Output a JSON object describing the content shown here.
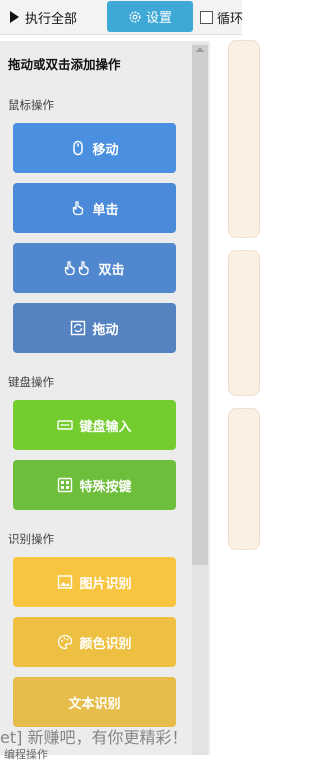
{
  "toolbar": {
    "run_all": "执行全部",
    "settings": "设置",
    "loop_label": "循环"
  },
  "panel": {
    "title": "拖动或双击添加操作",
    "sections": {
      "mouse": "鼠标操作",
      "keyboard": "键盘操作",
      "recognition": "识别操作"
    },
    "buttons": {
      "move": "移动",
      "click": "单击",
      "double_click": "双击",
      "drag": "拖动",
      "keyboard_input": "键盘输入",
      "special_key": "特殊按键",
      "image_recognition": "图片识别",
      "color_recognition": "颜色识别",
      "text_recognition": "文本识别"
    }
  },
  "watermark": "et] 新赚吧，有你更精彩！",
  "footer_partial": "编程操作",
  "colors": {
    "settings_blue": "#3ea8d6",
    "mouse_blue": "#4a8fe0",
    "keyboard_green": "#6fc33a",
    "recognition_yellow": "#f5c541"
  },
  "icons": {
    "move": "mouse-icon",
    "click": "hand-pointer-icon",
    "double_click": "double-hand-icon",
    "drag": "drag-icon",
    "keyboard_input": "keyboard-icon",
    "special_key": "special-key-icon",
    "image_recognition": "image-icon",
    "color_recognition": "palette-icon"
  }
}
